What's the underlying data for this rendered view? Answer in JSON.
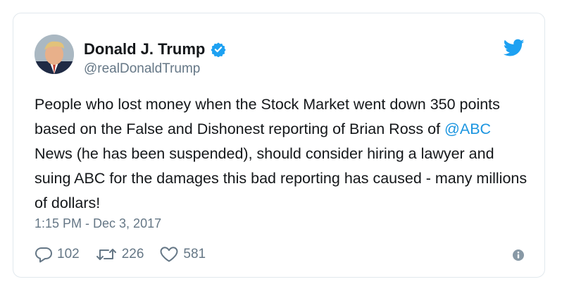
{
  "user": {
    "display_name": "Donald J. Trump",
    "handle": "@realDonaldTrump",
    "verified": true
  },
  "tweet": {
    "text_before": "People who lost money when the Stock Market went down 350 points based on the False and Dishonest reporting of Brian Ross of ",
    "mention": "@ABC",
    "text_after": " News (he has been suspended), should consider hiring a lawyer and suing ABC for the damages this bad reporting has caused - many millions of dollars!",
    "timestamp": "1:15 PM - Dec 3, 2017"
  },
  "actions": {
    "replies": "102",
    "retweets": "226",
    "likes": "581"
  },
  "icons": {
    "brand": "twitter-bird-icon",
    "verified": "verified-badge-icon",
    "reply": "reply-icon",
    "retweet": "retweet-icon",
    "like": "heart-icon",
    "info": "info-icon"
  },
  "colors": {
    "brand_blue": "#1da1f2",
    "mention_blue": "#1b95e0",
    "secondary_text": "#657786",
    "border": "#e1e8ed"
  }
}
